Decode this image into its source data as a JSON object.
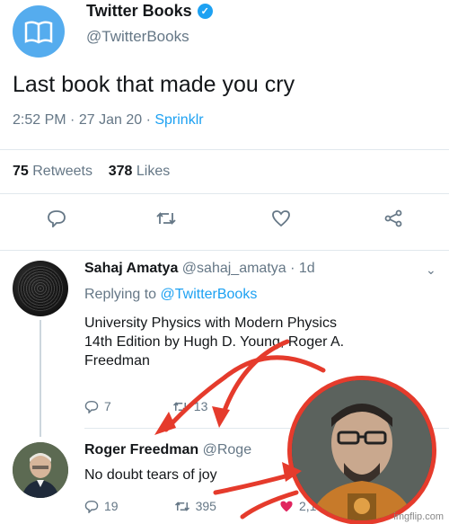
{
  "tweet": {
    "author_name": "Twitter Books",
    "author_handle": "@TwitterBooks",
    "text": "Last book that made you cry",
    "time": "2:52 PM",
    "date": "27 Jan 20",
    "source": "Sprinklr",
    "retweets_count": "75",
    "retweets_label": "Retweets",
    "likes_count": "378",
    "likes_label": "Likes"
  },
  "replies": [
    {
      "name": "Sahaj Amatya",
      "handle": "@sahaj_amatya",
      "age": "1d",
      "replying_prefix": "Replying to",
      "replying_to": "@TwitterBooks",
      "text_lines": [
        "University Physics with Modern Physics",
        "14th Edition by Hugh D. Young, Roger A.",
        "Freedman"
      ],
      "reply_count": "7",
      "retweet_count": "13"
    },
    {
      "name": "Roger Freedman",
      "handle": "@Roge",
      "text": "No doubt tears of joy",
      "reply_count": "19",
      "retweet_count": "395",
      "like_count": "2,1"
    }
  ],
  "watermark": "imgflip.com",
  "colors": {
    "accent": "#1da1f2",
    "muted": "#657786",
    "arrow": "#e53b2c"
  },
  "icons": [
    "book-icon",
    "verified-icon",
    "reply-icon",
    "retweet-icon",
    "like-icon",
    "share-icon",
    "chevron-down-icon"
  ]
}
